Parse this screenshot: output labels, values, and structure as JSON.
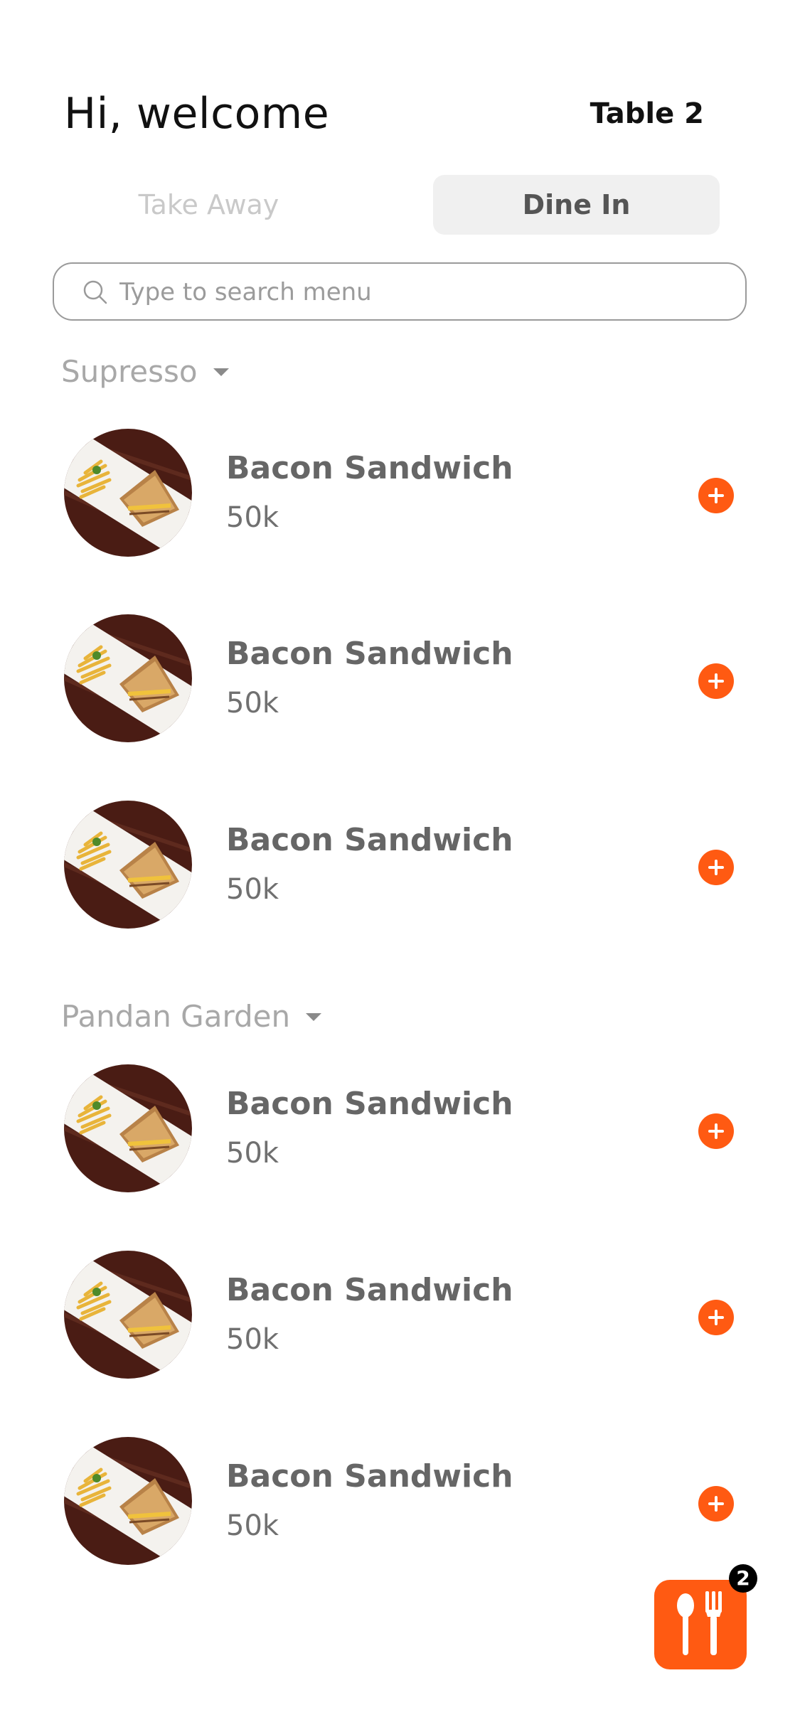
{
  "header": {
    "greeting": "Hi, welcome",
    "table": "Table 2"
  },
  "mode_tabs": [
    {
      "label": "Take Away",
      "active": false
    },
    {
      "label": "Dine In",
      "active": true
    }
  ],
  "search": {
    "placeholder": "Type to search menu",
    "value": ""
  },
  "categories": [
    {
      "name": "Supresso",
      "items": [
        {
          "name": "Bacon Sandwich",
          "price": "50k"
        },
        {
          "name": "Bacon Sandwich",
          "price": "50k"
        },
        {
          "name": "Bacon Sandwich",
          "price": "50k"
        }
      ]
    },
    {
      "name": "Pandan Garden",
      "items": [
        {
          "name": "Bacon Sandwich",
          "price": "50k"
        },
        {
          "name": "Bacon Sandwich",
          "price": "50k"
        },
        {
          "name": "Bacon Sandwich",
          "price": "50k"
        }
      ]
    }
  ],
  "cart": {
    "count": "2",
    "icon": "utensils-icon"
  },
  "colors": {
    "accent": "#ff5a12",
    "text_dark": "#111111",
    "text_muted": "#a8a8a8"
  }
}
